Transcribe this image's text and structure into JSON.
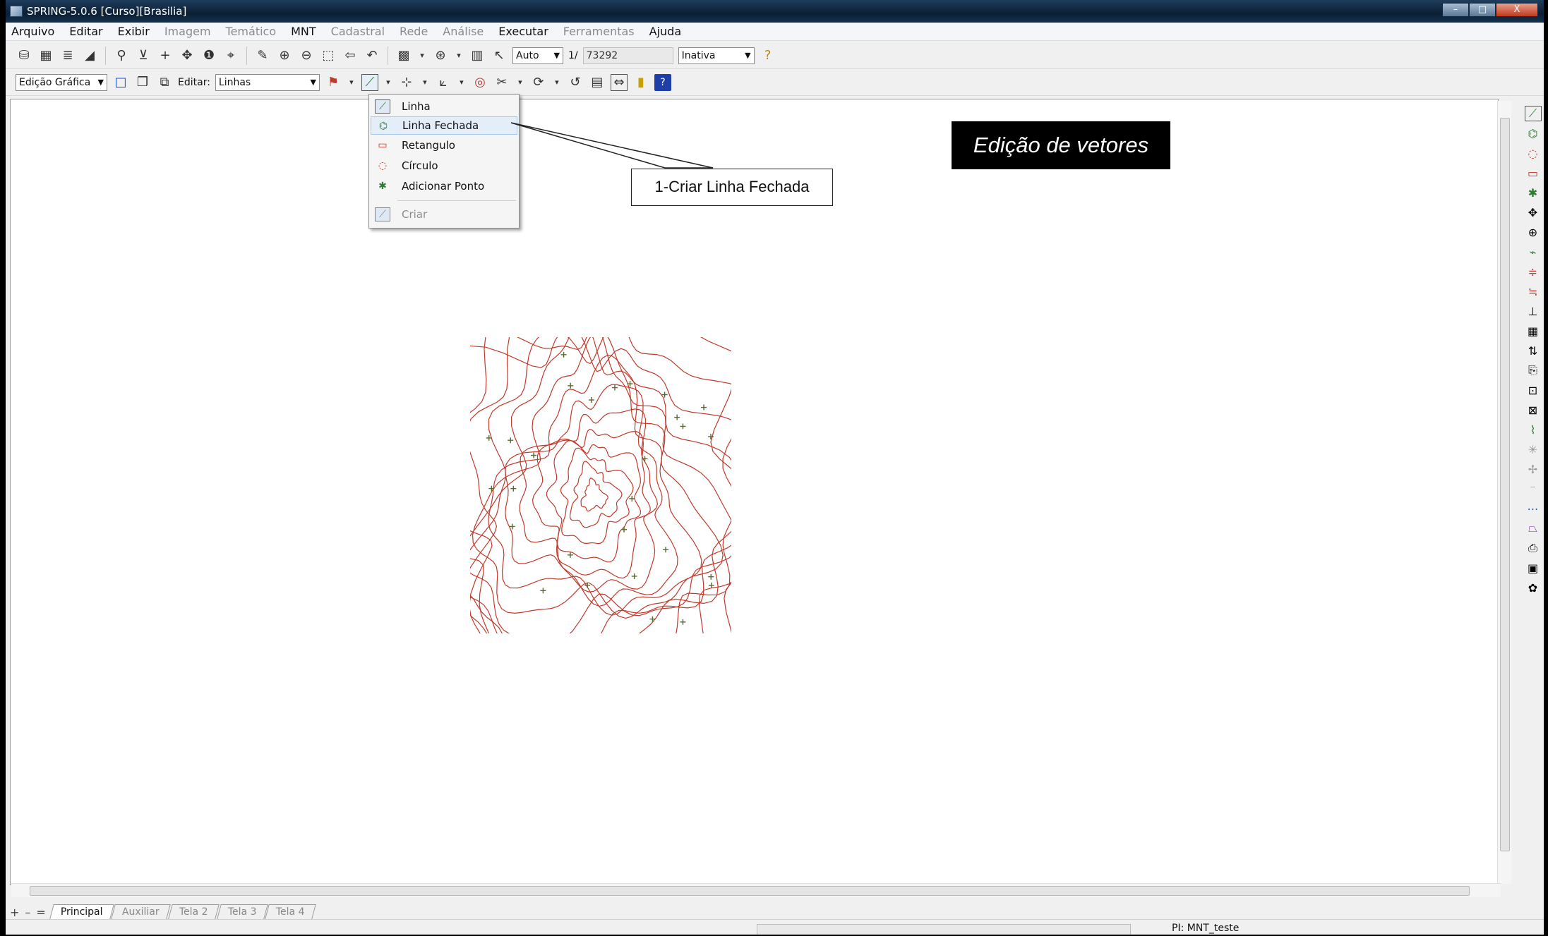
{
  "window": {
    "title": "SPRING-5.0.6 [Curso][Brasilia]",
    "controls": [
      "–",
      "□",
      "X"
    ]
  },
  "menubar": {
    "items": [
      {
        "label": "Arquivo",
        "enabled": true
      },
      {
        "label": "Editar",
        "enabled": true
      },
      {
        "label": "Exibir",
        "enabled": true
      },
      {
        "label": "Imagem",
        "enabled": false
      },
      {
        "label": "Temático",
        "enabled": false
      },
      {
        "label": "MNT",
        "enabled": true
      },
      {
        "label": "Cadastral",
        "enabled": false
      },
      {
        "label": "Rede",
        "enabled": false
      },
      {
        "label": "Análise",
        "enabled": false
      },
      {
        "label": "Executar",
        "enabled": true
      },
      {
        "label": "Ferramentas",
        "enabled": false
      },
      {
        "label": "Ajuda",
        "enabled": true
      }
    ]
  },
  "toolbar1": {
    "scale_mode": "Auto",
    "scale_prefix": "1/",
    "scale_value": "73292",
    "state": "Inativa"
  },
  "toolbar2": {
    "mode": "Edição Gráfica",
    "edit_label": "Editar:",
    "edit_value": "Linhas"
  },
  "dropdown": {
    "items": [
      {
        "label": "Linha",
        "icon": "line-tool-icon",
        "state": "normal"
      },
      {
        "label": "Linha Fechada",
        "icon": "closed-line-tool-icon",
        "state": "hover"
      },
      {
        "label": "Retangulo",
        "icon": "rectangle-tool-icon",
        "state": "normal"
      },
      {
        "label": "Círculo",
        "icon": "circle-tool-icon",
        "state": "normal"
      },
      {
        "label": "Adicionar Ponto",
        "icon": "add-point-tool-icon",
        "state": "normal"
      },
      {
        "label": "Criar",
        "icon": "create-tool-icon",
        "state": "disabled"
      }
    ]
  },
  "annotations": {
    "callout": "1-Criar Linha Fechada",
    "title": "Edição de vetores"
  },
  "tabs": [
    {
      "label": "Principal",
      "active": true
    },
    {
      "label": "Auxiliar",
      "active": false
    },
    {
      "label": "Tela 2",
      "active": false
    },
    {
      "label": "Tela 3",
      "active": false
    },
    {
      "label": "Tela 4",
      "active": false
    }
  ],
  "tab_controls": [
    "+",
    "–",
    "="
  ],
  "statusbar": {
    "pi": "PI: MNT_teste"
  },
  "colors": {
    "contour": "#c0392b",
    "sample_point": "#556b2f",
    "title_bg": "#000000"
  }
}
